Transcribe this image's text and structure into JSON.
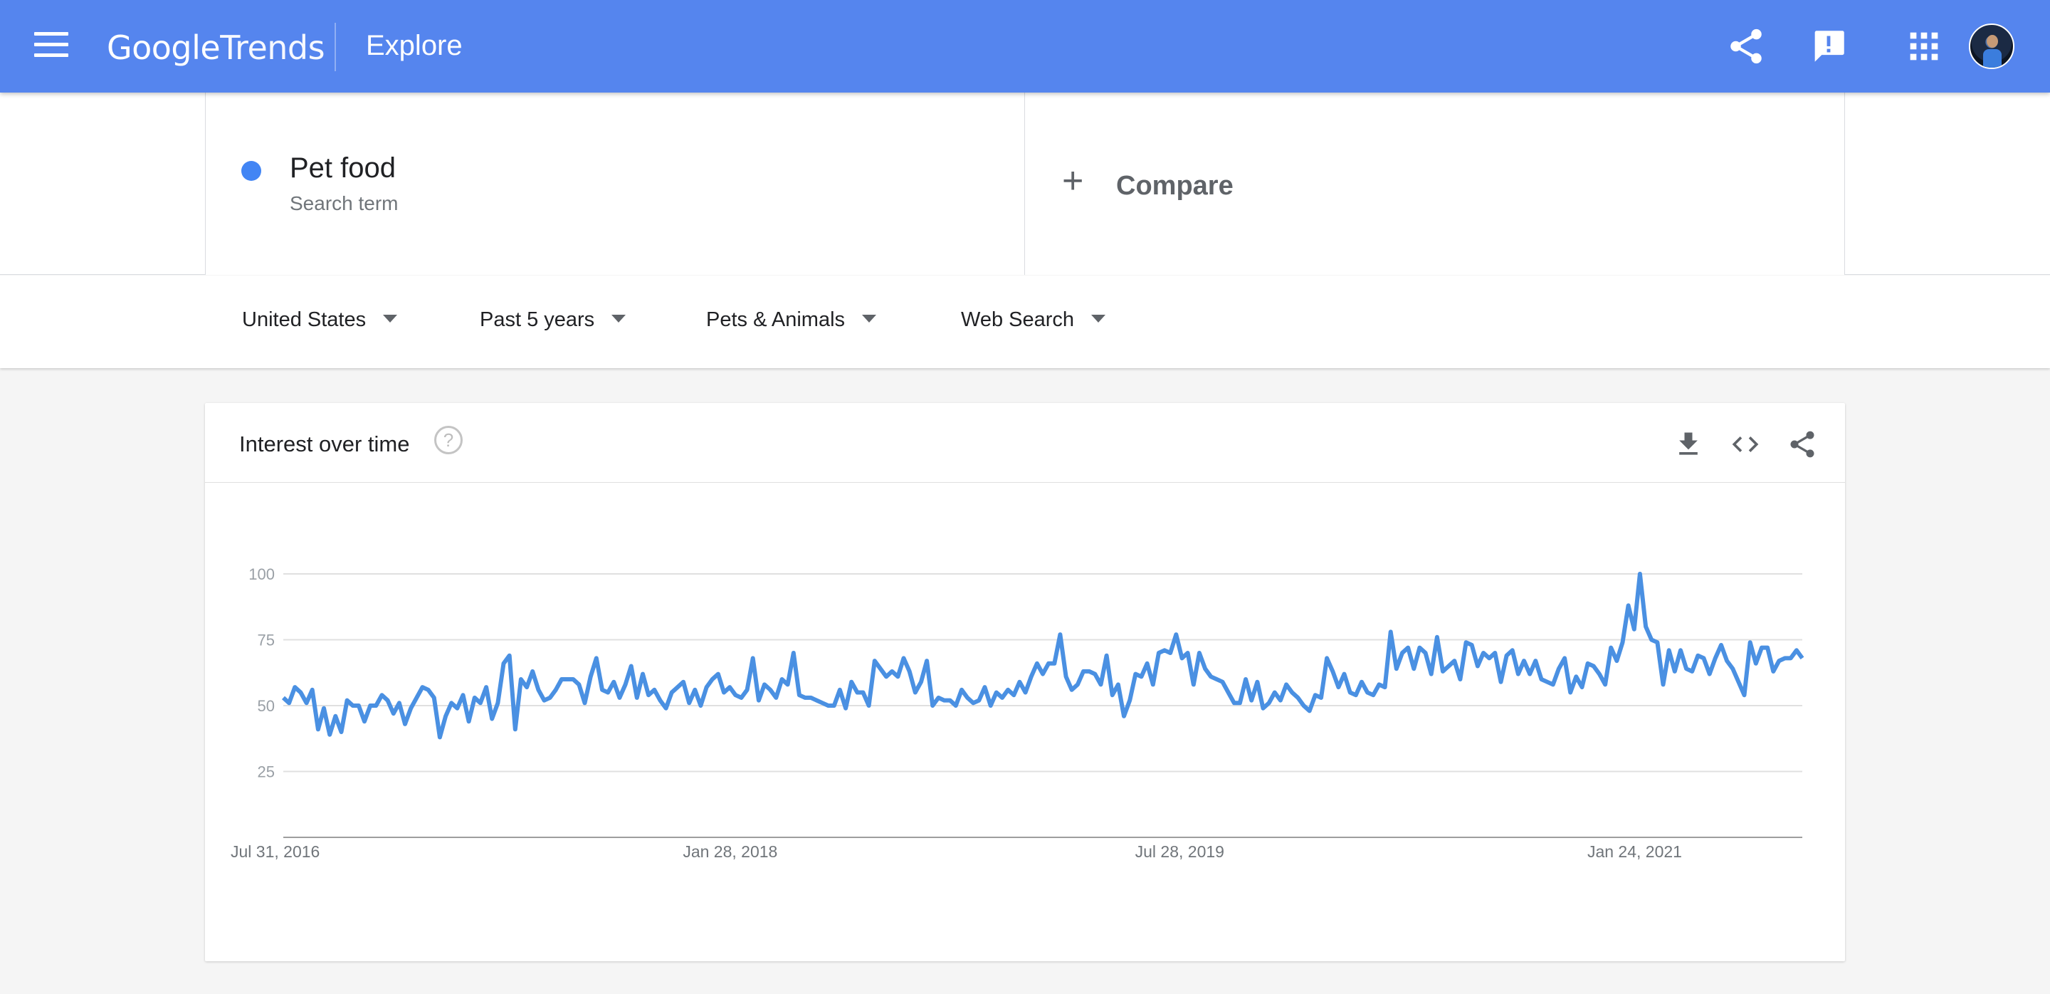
{
  "header": {
    "logo_google": "Google",
    "logo_trends": "Trends",
    "page": "Explore",
    "icons": [
      "menu-icon",
      "share-icon",
      "feedback-icon",
      "apps-icon",
      "avatar"
    ]
  },
  "terms": {
    "term1": {
      "name": "Pet food",
      "subtitle": "Search term",
      "color": "#4285f4"
    },
    "compare": {
      "plus": "+",
      "label": "Compare"
    }
  },
  "filters": {
    "country": "United States",
    "time": "Past 5 years",
    "category": "Pets & Animals",
    "property": "Web Search"
  },
  "card": {
    "title": "Interest over time",
    "help": "?",
    "tools": [
      "download-icon",
      "embed-icon",
      "share-icon"
    ]
  },
  "colors": {
    "header": "#5585ee",
    "series": "#4a90e2",
    "grid": "#e0e0e0"
  },
  "chart_data": {
    "type": "line",
    "title": "Interest over time",
    "xlabel": "",
    "ylabel": "",
    "ylim": [
      0,
      100
    ],
    "yticks": [
      25,
      50,
      75,
      100
    ],
    "x_start": "Jul 31, 2016",
    "x_end": "Jul 18, 2021",
    "x_tick_labels": [
      {
        "label": "Jul 31, 2016",
        "week": 0
      },
      {
        "label": "Jan 28, 2018",
        "week": 78
      },
      {
        "label": "Jul 28, 2019",
        "week": 156
      },
      {
        "label": "Jan 24, 2021",
        "week": 234
      }
    ],
    "grid": true,
    "series": [
      {
        "name": "Pet food",
        "values": [
          53,
          51,
          57,
          55,
          51,
          56,
          41,
          49,
          39,
          46,
          40,
          52,
          50,
          50,
          44,
          50,
          50,
          54,
          52,
          47,
          51,
          43,
          49,
          53,
          57,
          56,
          53,
          38,
          46,
          51,
          49,
          54,
          44,
          53,
          51,
          57,
          45,
          51,
          66,
          69,
          41,
          60,
          57,
          63,
          56,
          52,
          53,
          56,
          60,
          60,
          60,
          58,
          51,
          61,
          68,
          56,
          55,
          59,
          53,
          58,
          65,
          53,
          62,
          54,
          56,
          52,
          49,
          55,
          57,
          59,
          51,
          56,
          50,
          57,
          60,
          62,
          55,
          57,
          54,
          53,
          56,
          68,
          52,
          58,
          56,
          53,
          60,
          58,
          70,
          54,
          53,
          53,
          52,
          51,
          50,
          50,
          56,
          49,
          59,
          55,
          55,
          50,
          67,
          64,
          61,
          63,
          61,
          68,
          63,
          55,
          59,
          67,
          50,
          53,
          52,
          52,
          50,
          56,
          53,
          51,
          52,
          57,
          50,
          55,
          53,
          56,
          54,
          59,
          55,
          61,
          66,
          62,
          66,
          66,
          77,
          61,
          56,
          58,
          63,
          63,
          62,
          58,
          69,
          54,
          58,
          46,
          52,
          62,
          61,
          66,
          58,
          70,
          71,
          70,
          77,
          68,
          70,
          58,
          70,
          64,
          61,
          60,
          59,
          55,
          51,
          51,
          60,
          52,
          59,
          49,
          51,
          55,
          52,
          58,
          55,
          53,
          50,
          48,
          54,
          53,
          68,
          63,
          57,
          62,
          55,
          54,
          59,
          55,
          54,
          58,
          57,
          78,
          64,
          70,
          72,
          64,
          72,
          70,
          62,
          76,
          63,
          65,
          67,
          60,
          74,
          73,
          65,
          70,
          68,
          70,
          59,
          69,
          71,
          62,
          67,
          62,
          67,
          60,
          59,
          58,
          64,
          68,
          55,
          61,
          57,
          66,
          65,
          62,
          58,
          72,
          67,
          74,
          88,
          79,
          100,
          80,
          75,
          74,
          58,
          71,
          63,
          71,
          64,
          63,
          69,
          68,
          62,
          68,
          73,
          67,
          64,
          59,
          54,
          74,
          66,
          72,
          72,
          63,
          67,
          68,
          68,
          71,
          68
        ]
      }
    ]
  }
}
